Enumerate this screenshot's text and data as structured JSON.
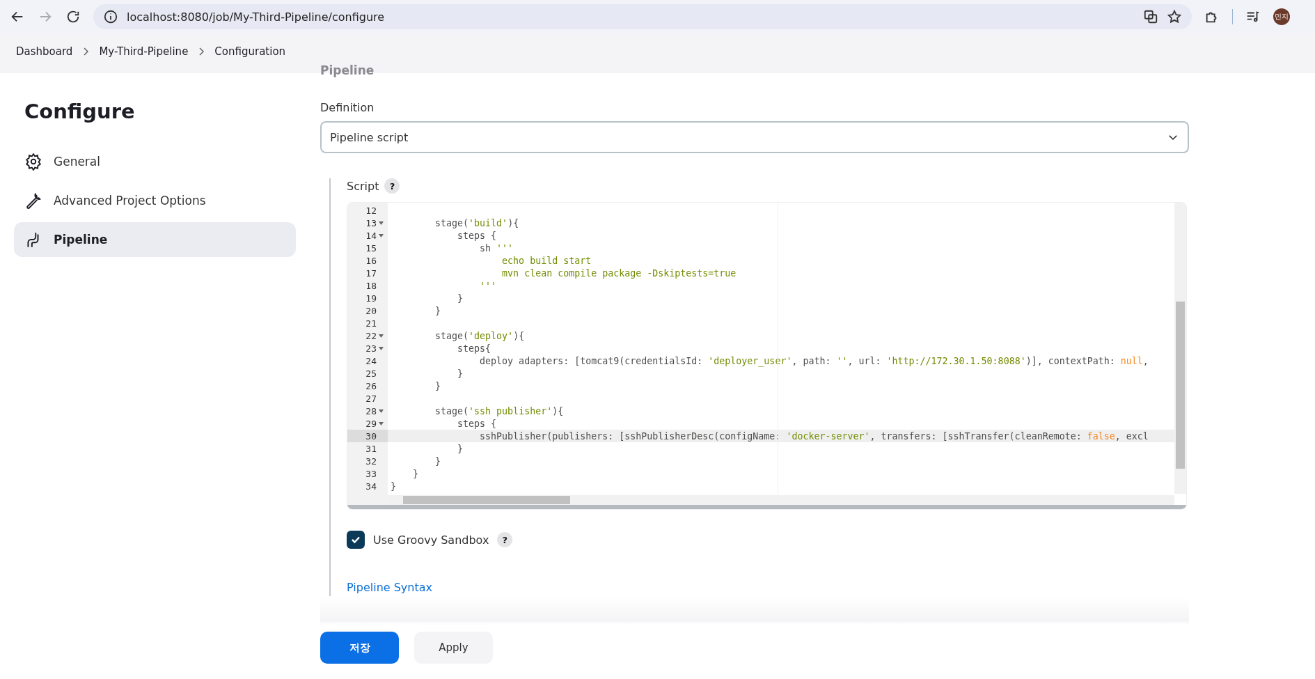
{
  "browser": {
    "url": "localhost:8080/job/My-Third-Pipeline/configure",
    "profile": "민지"
  },
  "breadcrumbs": [
    "Dashboard",
    "My-Third-Pipeline",
    "Configuration"
  ],
  "section_heading": "Pipeline",
  "sidebar": {
    "title": "Configure",
    "items": [
      {
        "label": "General",
        "selected": false
      },
      {
        "label": "Advanced Project Options",
        "selected": false
      },
      {
        "label": "Pipeline",
        "selected": true
      }
    ]
  },
  "definition": {
    "label": "Definition",
    "value": "Pipeline script"
  },
  "script": {
    "label": "Script",
    "help": "?",
    "lines": [
      {
        "number": "12",
        "fold": false,
        "active": false
      },
      {
        "number": "13",
        "fold": true,
        "active": false,
        "tokens": [
          {
            "text": "        stage(",
            "kind": "plain"
          },
          {
            "text": "'build'",
            "kind": "string"
          },
          {
            "text": "){",
            "kind": "plain"
          }
        ]
      },
      {
        "number": "14",
        "fold": true,
        "active": false,
        "tokens": [
          {
            "text": "            steps {",
            "kind": "plain"
          }
        ]
      },
      {
        "number": "15",
        "fold": false,
        "active": false,
        "tokens": [
          {
            "text": "                sh ",
            "kind": "plain"
          },
          {
            "text": "'''",
            "kind": "string"
          }
        ]
      },
      {
        "number": "16",
        "fold": false,
        "active": false,
        "tokens": [
          {
            "text": "                    echo build start",
            "kind": "string"
          }
        ]
      },
      {
        "number": "17",
        "fold": false,
        "active": false,
        "tokens": [
          {
            "text": "                    mvn clean compile package -Dskiptests=true",
            "kind": "string"
          }
        ]
      },
      {
        "number": "18",
        "fold": false,
        "active": false,
        "tokens": [
          {
            "text": "                '''",
            "kind": "string"
          }
        ]
      },
      {
        "number": "19",
        "fold": false,
        "active": false,
        "tokens": [
          {
            "text": "            }",
            "kind": "plain"
          }
        ]
      },
      {
        "number": "20",
        "fold": false,
        "active": false,
        "tokens": [
          {
            "text": "        }",
            "kind": "plain"
          }
        ]
      },
      {
        "number": "21",
        "fold": false,
        "active": false
      },
      {
        "number": "22",
        "fold": true,
        "active": false,
        "tokens": [
          {
            "text": "        stage(",
            "kind": "plain"
          },
          {
            "text": "'deploy'",
            "kind": "string"
          },
          {
            "text": "){",
            "kind": "plain"
          }
        ]
      },
      {
        "number": "23",
        "fold": true,
        "active": false,
        "tokens": [
          {
            "text": "            steps{",
            "kind": "plain"
          }
        ]
      },
      {
        "number": "24",
        "fold": false,
        "active": false,
        "tokens": [
          {
            "text": "                deploy adapters: [tomcat9(credentialsId: ",
            "kind": "plain"
          },
          {
            "text": "'deployer_user'",
            "kind": "string"
          },
          {
            "text": ", path: ",
            "kind": "plain"
          },
          {
            "text": "''",
            "kind": "string"
          },
          {
            "text": ", url: ",
            "kind": "plain"
          },
          {
            "text": "'http://172.30.1.50:8088'",
            "kind": "string"
          },
          {
            "text": ")], contextPath: ",
            "kind": "plain"
          },
          {
            "text": "null",
            "kind": "keyword"
          },
          {
            "text": ",",
            "kind": "plain"
          }
        ]
      },
      {
        "number": "25",
        "fold": false,
        "active": false,
        "tokens": [
          {
            "text": "            }",
            "kind": "plain"
          }
        ]
      },
      {
        "number": "26",
        "fold": false,
        "active": false,
        "tokens": [
          {
            "text": "        }",
            "kind": "plain"
          }
        ]
      },
      {
        "number": "27",
        "fold": false,
        "active": false
      },
      {
        "number": "28",
        "fold": true,
        "active": false,
        "tokens": [
          {
            "text": "        stage(",
            "kind": "plain"
          },
          {
            "text": "'ssh publisher'",
            "kind": "string"
          },
          {
            "text": "){",
            "kind": "plain"
          }
        ]
      },
      {
        "number": "29",
        "fold": true,
        "active": false,
        "tokens": [
          {
            "text": "            steps {",
            "kind": "plain"
          }
        ]
      },
      {
        "number": "30",
        "fold": false,
        "active": true,
        "tokens": [
          {
            "text": "                sshPublisher(publishers: [sshPublisherDesc(configName: ",
            "kind": "plain"
          },
          {
            "text": "'docker-server'",
            "kind": "string"
          },
          {
            "text": ", transfers: [sshTransfer(cleanRemote: ",
            "kind": "plain"
          },
          {
            "text": "false",
            "kind": "keyword"
          },
          {
            "text": ", excl",
            "kind": "plain"
          }
        ]
      },
      {
        "number": "31",
        "fold": false,
        "active": false,
        "tokens": [
          {
            "text": "            }",
            "kind": "plain"
          }
        ]
      },
      {
        "number": "32",
        "fold": false,
        "active": false,
        "tokens": [
          {
            "text": "        }",
            "kind": "plain"
          }
        ]
      },
      {
        "number": "33",
        "fold": false,
        "active": false,
        "tokens": [
          {
            "text": "    }",
            "kind": "plain"
          }
        ]
      },
      {
        "number": "34",
        "fold": false,
        "active": false,
        "tokens": [
          {
            "text": "}",
            "kind": "plain"
          }
        ]
      }
    ]
  },
  "sandbox": {
    "label": "Use Groovy Sandbox",
    "checked": true,
    "help": "?"
  },
  "syntax_link": "Pipeline Syntax",
  "buttons": [
    {
      "label": "저장",
      "kind": "primary"
    },
    {
      "label": "Apply",
      "kind": "secondary"
    }
  ]
}
